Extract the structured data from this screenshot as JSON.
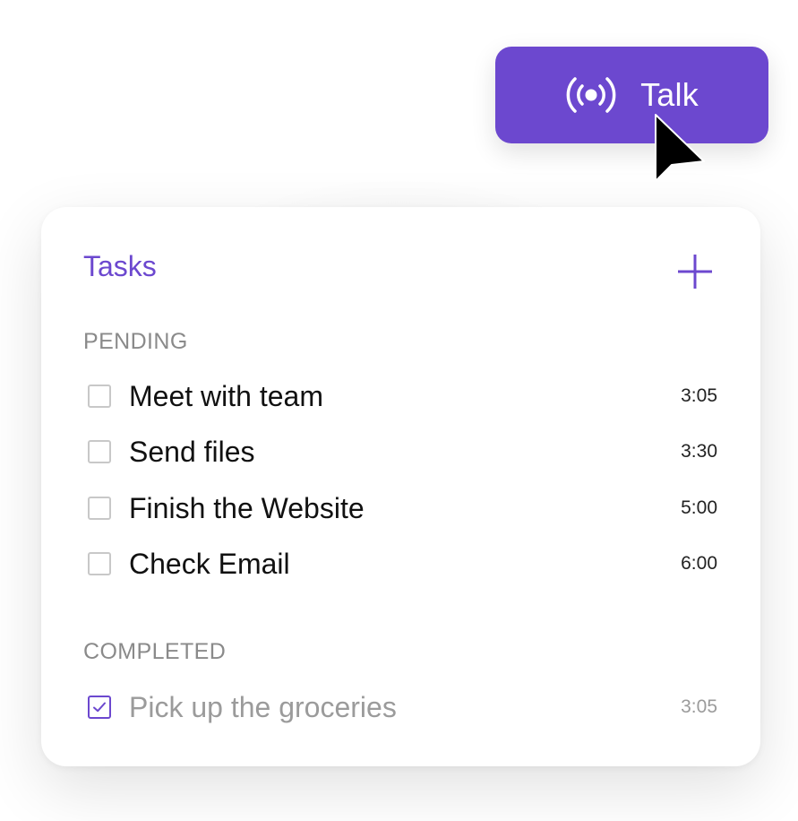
{
  "talk_button": {
    "label": "Talk",
    "icon": "broadcast-icon"
  },
  "accent_color": "#6c48cf",
  "tasks_card": {
    "title": "Tasks",
    "add_icon": "plus-icon",
    "pending_label": "PENDING",
    "completed_label": "COMPLETED",
    "pending": [
      {
        "text": "Meet with team",
        "time": "3:05",
        "checked": false
      },
      {
        "text": "Send files",
        "time": "3:30",
        "checked": false
      },
      {
        "text": "Finish the Website",
        "time": "5:00",
        "checked": false
      },
      {
        "text": "Check Email",
        "time": "6:00",
        "checked": false
      }
    ],
    "completed": [
      {
        "text": "Pick up the groceries",
        "time": "3:05",
        "checked": true
      }
    ]
  }
}
